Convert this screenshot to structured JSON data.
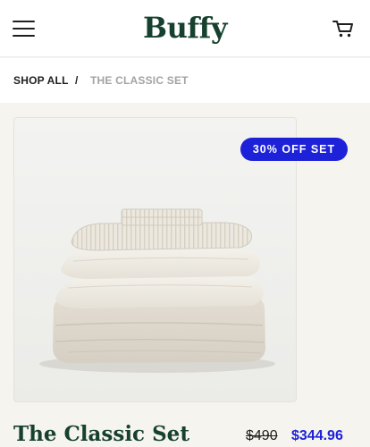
{
  "header": {
    "logo": "Buffy",
    "menu_icon": "hamburger-menu-icon",
    "cart_icon": "shopping-cart-icon"
  },
  "breadcrumb": {
    "items": [
      "SHOP ALL",
      "THE CLASSIC SET"
    ],
    "separator": "/"
  },
  "product": {
    "badge": "30% OFF SET",
    "title": "The Classic Set",
    "price_original": "$490",
    "price_sale": "$344.96"
  },
  "colors": {
    "brand_green": "#17412f",
    "accent_blue": "#1d22d9",
    "page_background": "#f6f4ef"
  }
}
